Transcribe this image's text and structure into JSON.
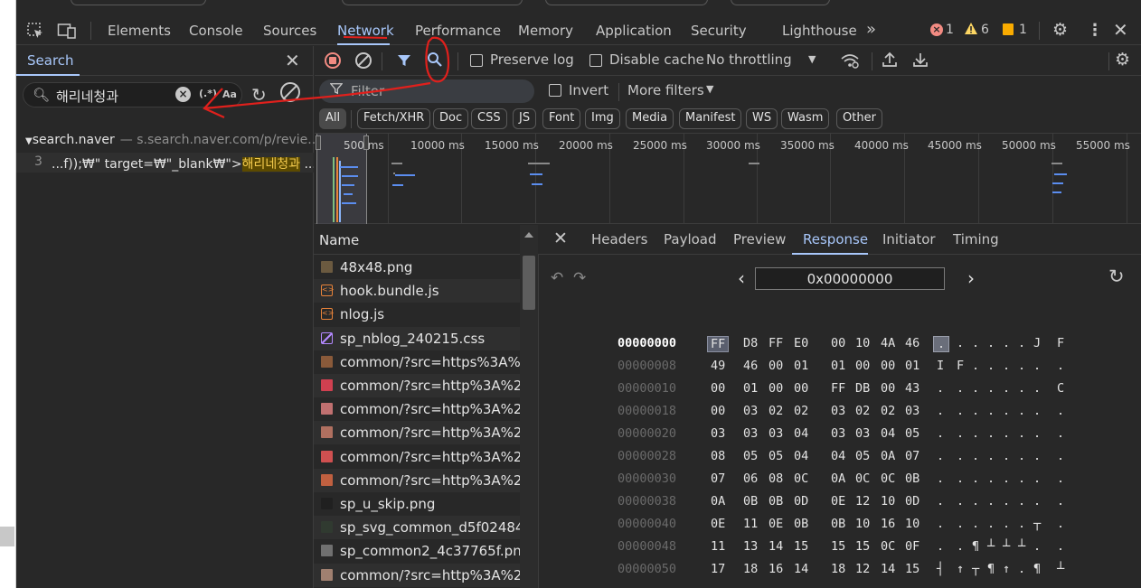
{
  "tabs": {
    "items": [
      "Elements",
      "Console",
      "Sources",
      "Network",
      "Performance",
      "Memory",
      "Application",
      "Security",
      "Lighthouse"
    ],
    "more": "»",
    "errors": "1",
    "warnings": "6",
    "issues": "1"
  },
  "search": {
    "title": "Search",
    "query": "해리네청과",
    "regex_label": "(.*)",
    "case_label": "Aa",
    "result_file": "search.naver",
    "result_url": "— s.search.naver.com/p/revie...",
    "result_line_no": "3",
    "result_prefix": "...f));₩\" target=₩\"_blank₩\">",
    "result_match": "해리네청과",
    "result_suffix": " ..."
  },
  "network_toolbar": {
    "preserve_log": "Preserve log",
    "disable_cache": "Disable cache",
    "throttling": "No throttling"
  },
  "filter": {
    "placeholder": "Filter",
    "invert": "Invert",
    "more_filters": "More filters"
  },
  "types": [
    "All",
    "Fetch/XHR",
    "Doc",
    "CSS",
    "JS",
    "Font",
    "Img",
    "Media",
    "Manifest",
    "WS",
    "Wasm",
    "Other"
  ],
  "timeline": {
    "ticks": [
      "500 ms",
      "10000 ms",
      "15000 ms",
      "20000 ms",
      "25000 ms",
      "30000 ms",
      "35000 ms",
      "40000 ms",
      "45000 ms",
      "50000 ms",
      "55000 ms"
    ]
  },
  "requests": {
    "header": "Name",
    "rows": [
      {
        "name": "48x48.png",
        "icon": "image-icon",
        "color": "#6b5a40"
      },
      {
        "name": "hook.bundle.js",
        "icon": "script-icon",
        "color": "#e8833a"
      },
      {
        "name": "nlog.js",
        "icon": "script-icon",
        "color": "#e8833a"
      },
      {
        "name": "sp_nblog_240215.css",
        "icon": "stylesheet-icon",
        "color": "#b388ff"
      },
      {
        "name": "common/?src=https%3A%...",
        "icon": "image-icon",
        "color": "#8a5a3a"
      },
      {
        "name": "common/?src=http%3A%2...",
        "icon": "image-icon",
        "color": "#d04050"
      },
      {
        "name": "common/?src=http%3A%2...",
        "icon": "image-icon",
        "color": "#c07070"
      },
      {
        "name": "common/?src=http%3A%2...",
        "icon": "image-icon",
        "color": "#b07060"
      },
      {
        "name": "common/?src=http%3A%2...",
        "icon": "image-icon",
        "color": "#d05050"
      },
      {
        "name": "common/?src=http%3A%2...",
        "icon": "image-icon",
        "color": "#c06040"
      },
      {
        "name": "sp_u_skip.png",
        "icon": "image-icon",
        "color": "#202020"
      },
      {
        "name": "sp_svg_common_d5f02484....",
        "icon": "image-icon",
        "color": "#303a30"
      },
      {
        "name": "sp_common2_4c37765f.png",
        "icon": "image-icon",
        "color": "#707070"
      },
      {
        "name": "common/?src=http%3A%2...",
        "icon": "image-icon",
        "color": "#a08070"
      }
    ]
  },
  "response": {
    "tabs": [
      "Headers",
      "Payload",
      "Preview",
      "Response",
      "Initiator",
      "Timing"
    ],
    "offset": "0x00000000",
    "rows": [
      {
        "off": "00000000",
        "bytes": [
          "FF",
          "D8",
          "FF",
          "E0",
          "00",
          "10",
          "4A",
          "46"
        ],
        "ascii": [
          ".",
          ".",
          ".",
          ".",
          ".",
          ".",
          "J",
          "F"
        ]
      },
      {
        "off": "00000008",
        "bytes": [
          "49",
          "46",
          "00",
          "01",
          "01",
          "00",
          "00",
          "01"
        ],
        "ascii": [
          "I",
          "F",
          ".",
          ".",
          ".",
          ".",
          ".",
          "."
        ]
      },
      {
        "off": "00000010",
        "bytes": [
          "00",
          "01",
          "00",
          "00",
          "FF",
          "DB",
          "00",
          "43"
        ],
        "ascii": [
          ".",
          ".",
          ".",
          ".",
          ".",
          ".",
          ".",
          "C"
        ]
      },
      {
        "off": "00000018",
        "bytes": [
          "00",
          "03",
          "02",
          "02",
          "03",
          "02",
          "02",
          "03"
        ],
        "ascii": [
          ".",
          ".",
          ".",
          ".",
          ".",
          ".",
          ".",
          "."
        ]
      },
      {
        "off": "00000020",
        "bytes": [
          "03",
          "03",
          "03",
          "04",
          "03",
          "03",
          "04",
          "05"
        ],
        "ascii": [
          ".",
          ".",
          ".",
          ".",
          ".",
          ".",
          ".",
          "."
        ]
      },
      {
        "off": "00000028",
        "bytes": [
          "08",
          "05",
          "05",
          "04",
          "04",
          "05",
          "0A",
          "07"
        ],
        "ascii": [
          ".",
          ".",
          ".",
          ".",
          ".",
          ".",
          ".",
          "."
        ]
      },
      {
        "off": "00000030",
        "bytes": [
          "07",
          "06",
          "08",
          "0C",
          "0A",
          "0C",
          "0C",
          "0B"
        ],
        "ascii": [
          ".",
          ".",
          ".",
          ".",
          ".",
          ".",
          ".",
          "."
        ]
      },
      {
        "off": "00000038",
        "bytes": [
          "0A",
          "0B",
          "0B",
          "0D",
          "0E",
          "12",
          "10",
          "0D"
        ],
        "ascii": [
          ".",
          ".",
          ".",
          ".",
          ".",
          ".",
          ".",
          "."
        ]
      },
      {
        "off": "00000040",
        "bytes": [
          "0E",
          "11",
          "0E",
          "0B",
          "0B",
          "10",
          "16",
          "10"
        ],
        "ascii": [
          ".",
          ".",
          ".",
          ".",
          ".",
          ".",
          "┬",
          "."
        ]
      },
      {
        "off": "00000048",
        "bytes": [
          "11",
          "13",
          "14",
          "15",
          "15",
          "15",
          "0C",
          "0F"
        ],
        "ascii": [
          ".",
          ".",
          "¶",
          "┴",
          "┴",
          "┴",
          ".",
          "."
        ]
      },
      {
        "off": "00000050",
        "bytes": [
          "17",
          "18",
          "16",
          "14",
          "18",
          "12",
          "14",
          "15"
        ],
        "ascii": [
          "┤",
          "↑",
          "┬",
          "¶",
          "↑",
          ".",
          "¶",
          "┴"
        ]
      }
    ]
  }
}
